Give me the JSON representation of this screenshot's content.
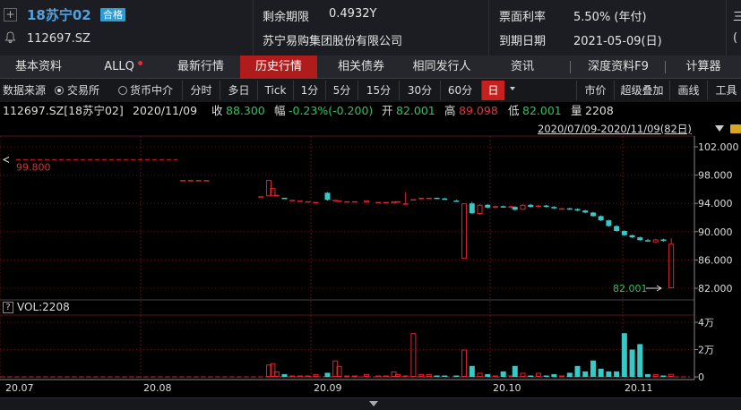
{
  "header": {
    "bond_name": "18苏宁02",
    "badge": "合格",
    "bond_code": "112697.SZ",
    "plus_icon": "plus-icon",
    "bell_icon": "bell-icon",
    "fields": [
      {
        "label": "剩余期限",
        "value": "0.4932Y"
      },
      {
        "label": "苏宁易购集团股份有限公司",
        "value": ""
      },
      {
        "label": "票面利率",
        "value": "5.50% (年付)"
      },
      {
        "label": "到期日期",
        "value": "2021-05-09(日)"
      }
    ],
    "clip_top": "三",
    "clip_bottom": "("
  },
  "tabs": [
    {
      "label": "基本资料"
    },
    {
      "label": "ALLQ",
      "dot": true
    },
    {
      "label": "最新行情"
    },
    {
      "label": "历史行情",
      "active": true
    },
    {
      "label": "相关债券"
    },
    {
      "label": "相同发行人"
    },
    {
      "label": "资讯"
    },
    {
      "label": "深度资料F9"
    },
    {
      "label": "计算器"
    }
  ],
  "toolbar": {
    "source_label": "数据来源",
    "radio_exchange": "交易所",
    "radio_money": "货币中介",
    "periods": [
      "分时",
      "多日",
      "Tick",
      "1分",
      "5分",
      "15分",
      "30分",
      "60分",
      "日"
    ],
    "active_period": "日",
    "right_buttons": [
      "市价",
      "超级叠加",
      "画线",
      "工具"
    ]
  },
  "info": {
    "code": "112697.SZ[18苏宁02]",
    "date": "2020/11/09",
    "close_label": "收",
    "close": "88.300",
    "change_label": "幅",
    "change": "-0.23%(-0.200)",
    "open_label": "开",
    "open": "82.001",
    "high_label": "高",
    "high": "89.098",
    "low_label": "低",
    "low": "82.001",
    "vol_label": "量",
    "volume": "2208"
  },
  "range": {
    "text": "2020/07/09-2020/11/09(82日)"
  },
  "volume_panel": {
    "label": "VOL:2208",
    "help": "?"
  },
  "colors": {
    "up": "#e0242b",
    "down": "#36c9c6",
    "bg": "#000000",
    "grid": "#5a1515",
    "ma": "#a51010"
  },
  "chart_data": {
    "type": "candlestick",
    "y_ticks": [
      "102.000",
      "98.000",
      "94.000",
      "90.000",
      "86.000",
      "82.000"
    ],
    "ylim": [
      82,
      102
    ],
    "x_ticks": [
      "20.07",
      "20.08",
      "20.09",
      "20.10",
      "20.11"
    ],
    "annotations": {
      "max_label": "99.800",
      "min_label": "82.001"
    },
    "volume_ticks": [
      "4万",
      "2万",
      "0"
    ],
    "volume_ylim": [
      0,
      40000
    ],
    "candles": [
      {
        "o": 97.3,
        "c": 97.3,
        "h": 97.3,
        "l": 97.3,
        "v": 0,
        "i": 46
      },
      {
        "o": 97.3,
        "c": 97.3,
        "h": 97.3,
        "l": 97.3,
        "v": 0,
        "i": 48
      },
      {
        "o": 97.3,
        "c": 97.3,
        "h": 97.3,
        "l": 97.3,
        "v": 0,
        "i": 50
      },
      {
        "o": 97.3,
        "c": 97.3,
        "h": 97.3,
        "l": 97.3,
        "v": 0,
        "i": 52
      },
      {
        "o": 95.0,
        "c": 95.0,
        "h": 95.0,
        "l": 95.0,
        "v": 0,
        "i": 66
      },
      {
        "o": 95.0,
        "c": 97.3,
        "h": 97.3,
        "l": 95.0,
        "v": 9000,
        "i": 68
      },
      {
        "o": 95.0,
        "c": 96.2,
        "h": 96.2,
        "l": 95.0,
        "v": 10000,
        "i": 69
      },
      {
        "o": 95.0,
        "c": 95.2,
        "h": 95.2,
        "l": 95.0,
        "v": 4000,
        "i": 70
      },
      {
        "o": 94.8,
        "c": 94.6,
        "h": 94.8,
        "l": 94.6,
        "v": 2000,
        "i": 72
      },
      {
        "o": 94.5,
        "c": 94.5,
        "h": 94.5,
        "l": 94.5,
        "v": 1000,
        "i": 74
      },
      {
        "o": 94.4,
        "c": 94.4,
        "h": 94.4,
        "l": 94.4,
        "v": 1000,
        "i": 76
      },
      {
        "o": 94.3,
        "c": 94.3,
        "h": 94.3,
        "l": 94.3,
        "v": 1000,
        "i": 78
      },
      {
        "o": 94.2,
        "c": 94.2,
        "h": 94.2,
        "l": 94.2,
        "v": 2000,
        "i": 80
      },
      {
        "o": 95.5,
        "c": 94.5,
        "h": 95.6,
        "l": 94.4,
        "v": 3000,
        "i": 83
      },
      {
        "o": 94.3,
        "c": 94.5,
        "h": 94.5,
        "l": 94.3,
        "v": 12000,
        "i": 85
      },
      {
        "o": 94.4,
        "c": 94.4,
        "h": 94.4,
        "l": 94.4,
        "v": 8000,
        "i": 86
      },
      {
        "o": 94.3,
        "c": 94.3,
        "h": 94.3,
        "l": 94.3,
        "v": 1000,
        "i": 88
      },
      {
        "o": 94.3,
        "c": 94.3,
        "h": 94.3,
        "l": 94.3,
        "v": 1000,
        "i": 90
      },
      {
        "o": 94.1,
        "c": 94.4,
        "h": 94.4,
        "l": 94.1,
        "v": 2000,
        "i": 93
      },
      {
        "o": 94.2,
        "c": 94.2,
        "h": 94.2,
        "l": 94.2,
        "v": 1000,
        "i": 96
      },
      {
        "o": 94.2,
        "c": 94.2,
        "h": 94.2,
        "l": 94.2,
        "v": 1000,
        "i": 98
      },
      {
        "o": 94.0,
        "c": 94.3,
        "h": 94.3,
        "l": 94.0,
        "v": 4000,
        "i": 100
      },
      {
        "o": 94.1,
        "c": 94.3,
        "h": 94.3,
        "l": 94.1,
        "v": 2000,
        "i": 101
      },
      {
        "o": 94.0,
        "c": 94.0,
        "h": 95.6,
        "l": 94.0,
        "v": 1000,
        "i": 103
      },
      {
        "o": 94.6,
        "c": 94.6,
        "h": 94.6,
        "l": 94.6,
        "v": 32000,
        "i": 105
      },
      {
        "o": 94.6,
        "c": 94.8,
        "h": 94.8,
        "l": 94.5,
        "v": 2000,
        "i": 107
      },
      {
        "o": 94.6,
        "c": 94.8,
        "h": 94.8,
        "l": 94.6,
        "v": 2000,
        "i": 109
      },
      {
        "o": 94.8,
        "c": 94.7,
        "h": 94.8,
        "l": 94.6,
        "v": 1000,
        "i": 111
      },
      {
        "o": 94.7,
        "c": 94.5,
        "h": 94.8,
        "l": 94.5,
        "v": 1000,
        "i": 113
      },
      {
        "o": 94.4,
        "c": 94.3,
        "h": 94.5,
        "l": 94.3,
        "v": 1000,
        "i": 116
      },
      {
        "o": 86.2,
        "c": 94.0,
        "h": 94.0,
        "l": 86.2,
        "v": 20000,
        "i": 118
      },
      {
        "o": 94.0,
        "c": 92.6,
        "h": 94.2,
        "l": 92.5,
        "v": 8000,
        "i": 120
      },
      {
        "o": 92.5,
        "c": 93.8,
        "h": 93.9,
        "l": 92.4,
        "v": 3000,
        "i": 122
      },
      {
        "o": 93.8,
        "c": 93.4,
        "h": 93.9,
        "l": 93.3,
        "v": 2000,
        "i": 124
      },
      {
        "o": 93.4,
        "c": 93.6,
        "h": 93.7,
        "l": 93.3,
        "v": 1000,
        "i": 126
      },
      {
        "o": 93.6,
        "c": 93.5,
        "h": 93.7,
        "l": 93.4,
        "v": 4000,
        "i": 128
      },
      {
        "o": 93.4,
        "c": 93.6,
        "h": 93.7,
        "l": 93.3,
        "v": 1000,
        "i": 130
      },
      {
        "o": 93.5,
        "c": 93.1,
        "h": 93.6,
        "l": 93.0,
        "v": 8000,
        "i": 131
      },
      {
        "o": 93.1,
        "c": 93.8,
        "h": 93.9,
        "l": 93.1,
        "v": 3000,
        "i": 133
      },
      {
        "o": 93.8,
        "c": 93.5,
        "h": 93.9,
        "l": 93.4,
        "v": 1000,
        "i": 135
      },
      {
        "o": 93.5,
        "c": 93.7,
        "h": 93.8,
        "l": 93.4,
        "v": 3000,
        "i": 137
      },
      {
        "o": 93.7,
        "c": 93.5,
        "h": 93.8,
        "l": 93.4,
        "v": 1000,
        "i": 139
      },
      {
        "o": 93.5,
        "c": 93.3,
        "h": 93.6,
        "l": 93.2,
        "v": 2000,
        "i": 141
      },
      {
        "o": 93.3,
        "c": 93.3,
        "h": 93.4,
        "l": 93.2,
        "v": 1000,
        "i": 143
      },
      {
        "o": 93.3,
        "c": 93.2,
        "h": 93.4,
        "l": 93.1,
        "v": 3000,
        "i": 145
      },
      {
        "o": 93.2,
        "c": 93.0,
        "h": 93.3,
        "l": 92.9,
        "v": 8000,
        "i": 147
      },
      {
        "o": 93.0,
        "c": 92.7,
        "h": 93.1,
        "l": 92.6,
        "v": 4000,
        "i": 149
      },
      {
        "o": 92.7,
        "c": 92.2,
        "h": 92.8,
        "l": 92.1,
        "v": 12000,
        "i": 151
      },
      {
        "o": 92.2,
        "c": 91.6,
        "h": 92.3,
        "l": 91.5,
        "v": 6000,
        "i": 153
      },
      {
        "o": 91.6,
        "c": 90.8,
        "h": 91.7,
        "l": 90.7,
        "v": 4000,
        "i": 155
      },
      {
        "o": 90.8,
        "c": 90.1,
        "h": 90.9,
        "l": 90.0,
        "v": 4000,
        "i": 157
      },
      {
        "o": 90.1,
        "c": 89.5,
        "h": 90.2,
        "l": 89.4,
        "v": 32000,
        "i": 159
      },
      {
        "o": 89.5,
        "c": 89.2,
        "h": 89.6,
        "l": 89.1,
        "v": 20000,
        "i": 161
      },
      {
        "o": 89.2,
        "c": 88.8,
        "h": 89.3,
        "l": 88.7,
        "v": 24000,
        "i": 163
      },
      {
        "o": 88.8,
        "c": 88.7,
        "h": 89.0,
        "l": 88.6,
        "v": 2000,
        "i": 165
      },
      {
        "o": 88.5,
        "c": 88.9,
        "h": 89.0,
        "l": 88.4,
        "v": 2000,
        "i": 167
      },
      {
        "o": 88.9,
        "c": 88.7,
        "h": 89.0,
        "l": 88.6,
        "v": 1000,
        "i": 169
      },
      {
        "o": 82.001,
        "c": 88.3,
        "h": 89.098,
        "l": 82.001,
        "v": 2208,
        "i": 171
      }
    ],
    "ma": [
      99.8,
      99.8,
      99.8,
      99.8,
      99.8,
      99.8,
      99.8,
      99.8,
      99.8,
      99.8,
      99.8,
      99.8,
      99.8,
      99.8,
      99.8,
      99.8,
      99.8,
      99.8,
      99.8,
      99.8,
      99.8,
      99.8,
      99.8,
      99.8,
      99.8,
      99.8,
      99.8,
      99.8,
      99.8,
      99.8,
      99.8,
      99.8,
      99.8,
      99.8,
      99.8,
      99.8,
      99.8,
      99.8,
      99.8,
      99.8,
      99.8,
      99.8,
      99.8,
      99.8,
      99.8,
      99.8
    ]
  }
}
